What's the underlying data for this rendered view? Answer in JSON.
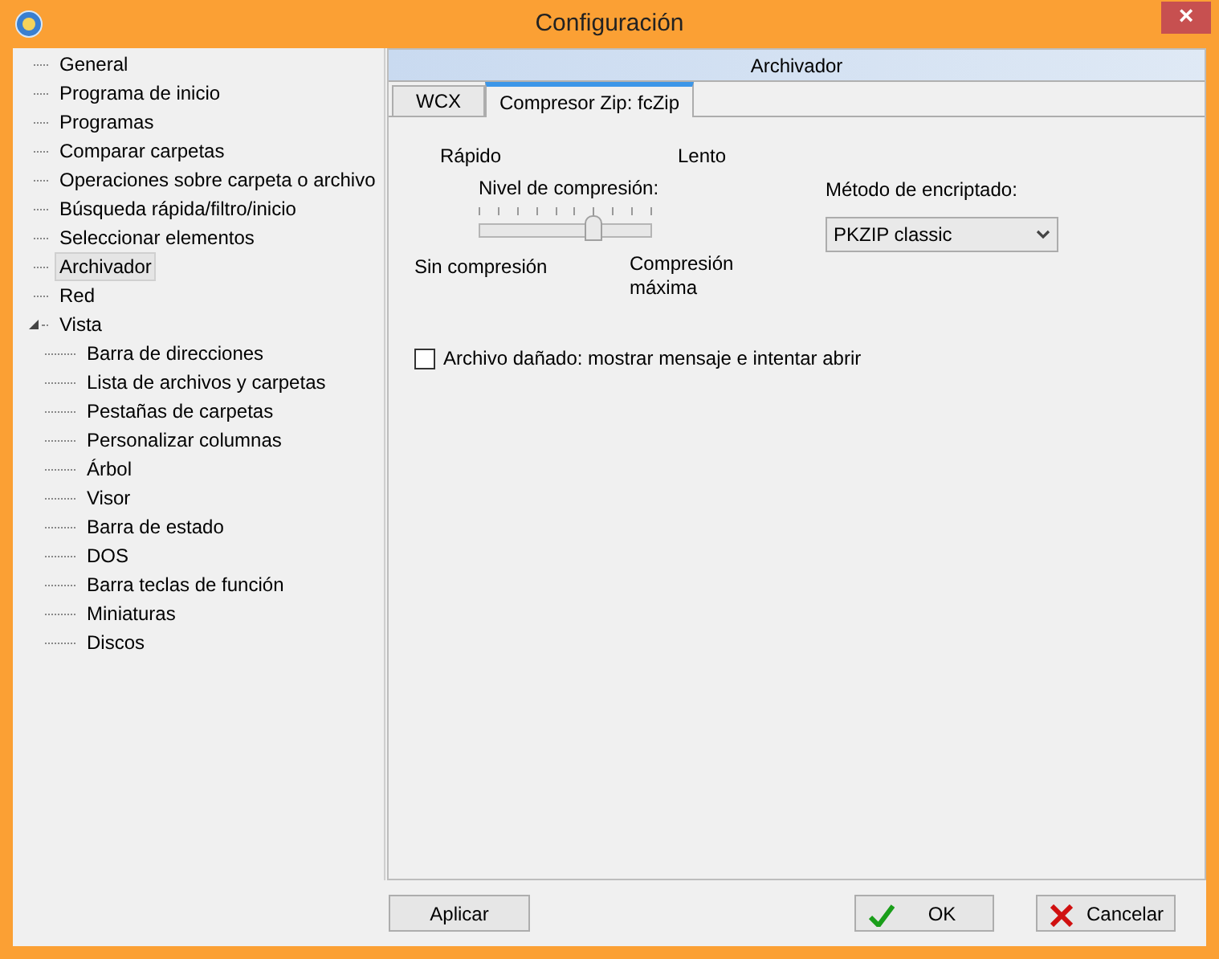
{
  "window": {
    "title": "Configuración",
    "close": "×"
  },
  "tree": [
    {
      "label": "General",
      "selected": false
    },
    {
      "label": "Programa de inicio",
      "selected": false
    },
    {
      "label": "Programas",
      "selected": false
    },
    {
      "label": "Comparar carpetas",
      "selected": false
    },
    {
      "label": "Operaciones sobre carpeta o archivo",
      "selected": false
    },
    {
      "label": "Búsqueda rápida/filtro/inicio",
      "selected": false
    },
    {
      "label": "Seleccionar elementos",
      "selected": false
    },
    {
      "label": "Archivador",
      "selected": true
    },
    {
      "label": "Red",
      "selected": false
    },
    {
      "label": "Vista",
      "selected": false,
      "expanded": true,
      "children": [
        {
          "label": "Barra de direcciones",
          "selected": false
        },
        {
          "label": "Lista de archivos y carpetas",
          "selected": false
        },
        {
          "label": "Pestañas de carpetas",
          "selected": false
        },
        {
          "label": "Personalizar columnas",
          "selected": false
        },
        {
          "label": "Árbol",
          "selected": false
        },
        {
          "label": "Visor",
          "selected": false
        },
        {
          "label": "Barra de estado",
          "selected": false
        },
        {
          "label": "DOS",
          "selected": false
        },
        {
          "label": "Barra teclas de función",
          "selected": false
        },
        {
          "label": "Miniaturas",
          "selected": false
        },
        {
          "label": "Discos",
          "selected": false
        }
      ]
    }
  ],
  "panel": {
    "title": "Archivador",
    "tabs": [
      {
        "label": "WCX",
        "selected": false
      },
      {
        "label": "Compresor Zip: fcZip",
        "selected": true
      }
    ],
    "slider": {
      "left_top": "Rápido",
      "right_top": "Lento",
      "label": "Nivel de compresión:",
      "level": 0.67,
      "left_bottom": "Sin compresión",
      "right_bottom": "Compresión máxima"
    },
    "encryption": {
      "label": "Método de encriptado:",
      "value": "PKZIP classic"
    },
    "checkbox": {
      "label": "Archivo dañado: mostrar mensaje e intentar abrir",
      "checked": false
    }
  },
  "buttons": [
    {
      "kind": "apply",
      "label": "Aplicar"
    },
    {
      "kind": "ok",
      "label": "OK"
    },
    {
      "kind": "cancel",
      "label": "Cancelar"
    }
  ]
}
